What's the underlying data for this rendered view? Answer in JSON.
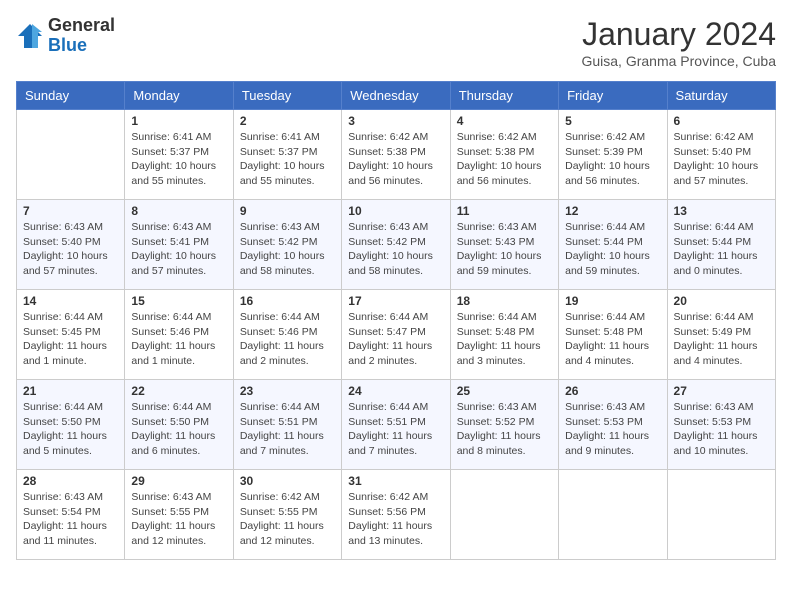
{
  "header": {
    "logo_general": "General",
    "logo_blue": "Blue",
    "month_year": "January 2024",
    "location": "Guisa, Granma Province, Cuba"
  },
  "days_of_week": [
    "Sunday",
    "Monday",
    "Tuesday",
    "Wednesday",
    "Thursday",
    "Friday",
    "Saturday"
  ],
  "weeks": [
    [
      {
        "day": "",
        "info": ""
      },
      {
        "day": "1",
        "info": "Sunrise: 6:41 AM\nSunset: 5:37 PM\nDaylight: 10 hours\nand 55 minutes."
      },
      {
        "day": "2",
        "info": "Sunrise: 6:41 AM\nSunset: 5:37 PM\nDaylight: 10 hours\nand 55 minutes."
      },
      {
        "day": "3",
        "info": "Sunrise: 6:42 AM\nSunset: 5:38 PM\nDaylight: 10 hours\nand 56 minutes."
      },
      {
        "day": "4",
        "info": "Sunrise: 6:42 AM\nSunset: 5:38 PM\nDaylight: 10 hours\nand 56 minutes."
      },
      {
        "day": "5",
        "info": "Sunrise: 6:42 AM\nSunset: 5:39 PM\nDaylight: 10 hours\nand 56 minutes."
      },
      {
        "day": "6",
        "info": "Sunrise: 6:42 AM\nSunset: 5:40 PM\nDaylight: 10 hours\nand 57 minutes."
      }
    ],
    [
      {
        "day": "7",
        "info": "Sunrise: 6:43 AM\nSunset: 5:40 PM\nDaylight: 10 hours\nand 57 minutes."
      },
      {
        "day": "8",
        "info": "Sunrise: 6:43 AM\nSunset: 5:41 PM\nDaylight: 10 hours\nand 57 minutes."
      },
      {
        "day": "9",
        "info": "Sunrise: 6:43 AM\nSunset: 5:42 PM\nDaylight: 10 hours\nand 58 minutes."
      },
      {
        "day": "10",
        "info": "Sunrise: 6:43 AM\nSunset: 5:42 PM\nDaylight: 10 hours\nand 58 minutes."
      },
      {
        "day": "11",
        "info": "Sunrise: 6:43 AM\nSunset: 5:43 PM\nDaylight: 10 hours\nand 59 minutes."
      },
      {
        "day": "12",
        "info": "Sunrise: 6:44 AM\nSunset: 5:44 PM\nDaylight: 10 hours\nand 59 minutes."
      },
      {
        "day": "13",
        "info": "Sunrise: 6:44 AM\nSunset: 5:44 PM\nDaylight: 11 hours\nand 0 minutes."
      }
    ],
    [
      {
        "day": "14",
        "info": "Sunrise: 6:44 AM\nSunset: 5:45 PM\nDaylight: 11 hours\nand 1 minute."
      },
      {
        "day": "15",
        "info": "Sunrise: 6:44 AM\nSunset: 5:46 PM\nDaylight: 11 hours\nand 1 minute."
      },
      {
        "day": "16",
        "info": "Sunrise: 6:44 AM\nSunset: 5:46 PM\nDaylight: 11 hours\nand 2 minutes."
      },
      {
        "day": "17",
        "info": "Sunrise: 6:44 AM\nSunset: 5:47 PM\nDaylight: 11 hours\nand 2 minutes."
      },
      {
        "day": "18",
        "info": "Sunrise: 6:44 AM\nSunset: 5:48 PM\nDaylight: 11 hours\nand 3 minutes."
      },
      {
        "day": "19",
        "info": "Sunrise: 6:44 AM\nSunset: 5:48 PM\nDaylight: 11 hours\nand 4 minutes."
      },
      {
        "day": "20",
        "info": "Sunrise: 6:44 AM\nSunset: 5:49 PM\nDaylight: 11 hours\nand 4 minutes."
      }
    ],
    [
      {
        "day": "21",
        "info": "Sunrise: 6:44 AM\nSunset: 5:50 PM\nDaylight: 11 hours\nand 5 minutes."
      },
      {
        "day": "22",
        "info": "Sunrise: 6:44 AM\nSunset: 5:50 PM\nDaylight: 11 hours\nand 6 minutes."
      },
      {
        "day": "23",
        "info": "Sunrise: 6:44 AM\nSunset: 5:51 PM\nDaylight: 11 hours\nand 7 minutes."
      },
      {
        "day": "24",
        "info": "Sunrise: 6:44 AM\nSunset: 5:51 PM\nDaylight: 11 hours\nand 7 minutes."
      },
      {
        "day": "25",
        "info": "Sunrise: 6:43 AM\nSunset: 5:52 PM\nDaylight: 11 hours\nand 8 minutes."
      },
      {
        "day": "26",
        "info": "Sunrise: 6:43 AM\nSunset: 5:53 PM\nDaylight: 11 hours\nand 9 minutes."
      },
      {
        "day": "27",
        "info": "Sunrise: 6:43 AM\nSunset: 5:53 PM\nDaylight: 11 hours\nand 10 minutes."
      }
    ],
    [
      {
        "day": "28",
        "info": "Sunrise: 6:43 AM\nSunset: 5:54 PM\nDaylight: 11 hours\nand 11 minutes."
      },
      {
        "day": "29",
        "info": "Sunrise: 6:43 AM\nSunset: 5:55 PM\nDaylight: 11 hours\nand 12 minutes."
      },
      {
        "day": "30",
        "info": "Sunrise: 6:42 AM\nSunset: 5:55 PM\nDaylight: 11 hours\nand 12 minutes."
      },
      {
        "day": "31",
        "info": "Sunrise: 6:42 AM\nSunset: 5:56 PM\nDaylight: 11 hours\nand 13 minutes."
      },
      {
        "day": "",
        "info": ""
      },
      {
        "day": "",
        "info": ""
      },
      {
        "day": "",
        "info": ""
      }
    ]
  ]
}
